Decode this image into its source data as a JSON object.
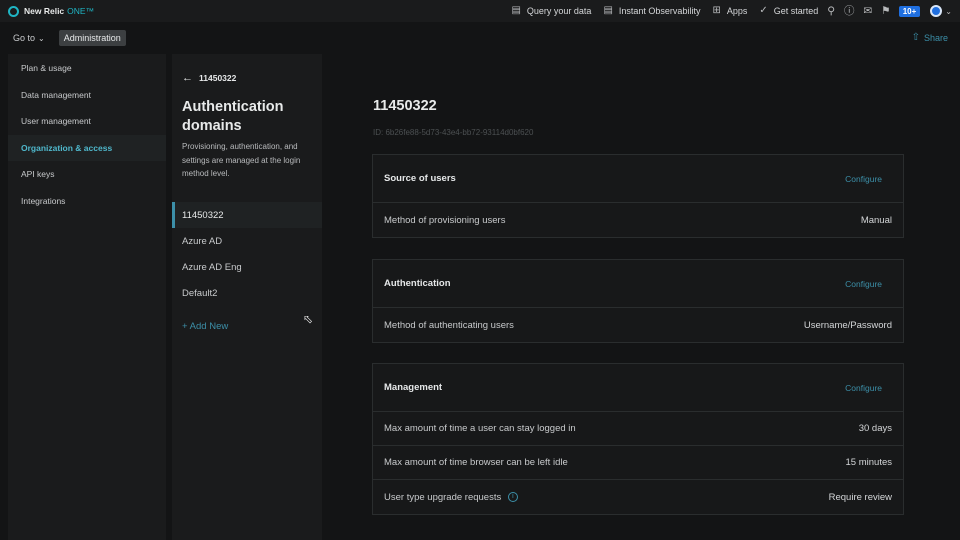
{
  "topbar": {
    "brand_name": "New Relic",
    "brand_sub": "ONE™",
    "nav": [
      {
        "label": "Query your data",
        "icon": "terminal-icon"
      },
      {
        "label": "Instant Observability",
        "icon": "chart-icon"
      },
      {
        "label": "Apps",
        "icon": "grid-icon"
      },
      {
        "label": "Get started",
        "icon": "check-circle-icon"
      }
    ],
    "badge": "10+"
  },
  "subbar": {
    "goto_label": "Go to",
    "breadcrumb": "Administration",
    "share_label": "Share"
  },
  "leftnav": {
    "items": [
      {
        "label": "Plan & usage"
      },
      {
        "label": "Data management"
      },
      {
        "label": "User management"
      },
      {
        "label": "Organization & access"
      },
      {
        "label": "API keys"
      },
      {
        "label": "Integrations"
      }
    ],
    "active_index": 3
  },
  "domains": {
    "back_label": "11450322",
    "title": "Authentication domains",
    "description": "Provisioning, authentication, and settings are managed at the login method level.",
    "items": [
      {
        "label": "11450322"
      },
      {
        "label": "Azure AD"
      },
      {
        "label": "Azure AD Eng"
      },
      {
        "label": "Default2"
      }
    ],
    "add_new_label": "+ Add New"
  },
  "main": {
    "title": "11450322",
    "id_text": "ID: 6b26fe88-5d73-43e4-bb72-93114d0bf620",
    "cards": [
      {
        "title": "Source of users",
        "action": "Configure",
        "rows": [
          {
            "label": "Method of provisioning users",
            "value": "Manual"
          }
        ]
      },
      {
        "title": "Authentication",
        "action": "Configure",
        "rows": [
          {
            "label": "Method of authenticating users",
            "value": "Username/Password"
          }
        ]
      },
      {
        "title": "Management",
        "action": "Configure",
        "rows": [
          {
            "label": "Max amount of time a user can stay logged in",
            "value": "30 days"
          },
          {
            "label": "Max amount of time browser can be left idle",
            "value": "15 minutes"
          },
          {
            "label": "User type upgrade requests",
            "value": "Require review"
          }
        ]
      }
    ]
  },
  "colors": {
    "accent": "#3c8fa8",
    "brand": "#1fb5c4",
    "badge": "#1f6fe0"
  }
}
